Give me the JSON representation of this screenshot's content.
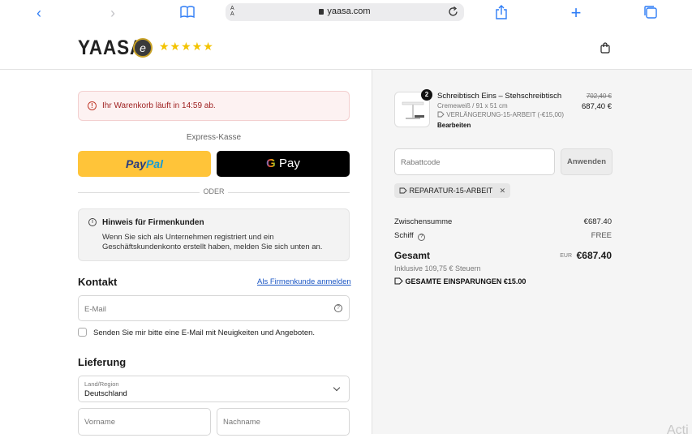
{
  "browser": {
    "url": "yaasa.com",
    "aa_label": "A A"
  },
  "header": {
    "logo": "YAASA",
    "seal_letter": "e",
    "stars": "★★★★★"
  },
  "cart_timer": "Ihr Warenkorb läuft in 14:59 ab.",
  "express": {
    "label": "Express-Kasse",
    "paypal_a": "Pay",
    "paypal_b": "Pal",
    "gpay_g": "G",
    "gpay_label": "Pay"
  },
  "oder": "ODER",
  "business_hint": {
    "title": "Hinweis für Firmenkunden",
    "body": "Wenn Sie sich als Unternehmen registriert und ein Geschäftskundenkonto erstellt haben, melden Sie sich unten an."
  },
  "contact": {
    "heading": "Kontakt",
    "business_login": "Als Firmenkunde anmelden",
    "email_placeholder": "E-Mail",
    "newsletter": "Senden Sie mir bitte eine E-Mail mit Neuigkeiten und Angeboten."
  },
  "delivery": {
    "heading": "Lieferung",
    "country_label": "Land/Region",
    "country_value": "Deutschland",
    "firstname_placeholder": "Vorname",
    "lastname_placeholder": "Nachname"
  },
  "summary": {
    "quantity": "2",
    "product_name": "Schreibtisch Eins – Stehschreibtisch",
    "variant": "Cremeweiß / 91 x 51 cm",
    "discount": "VERLÄNGERUNG-15-ARBEIT (-€15,00)",
    "edit": "Bearbeiten",
    "price_old": "702,40 €",
    "price_new": "687,40 €",
    "discount_placeholder": "Rabattcode",
    "apply": "Anwenden",
    "applied_code": "REPARATUR-15-ARBEIT",
    "subtotal_label": "Zwischensumme",
    "subtotal_value": "€687.40",
    "shipping_label": "Schiff",
    "shipping_value": "FREE",
    "total_label": "Gesamt",
    "currency": "EUR",
    "total_value": "€687.40",
    "taxes": "Inklusive 109,75 € Steuern",
    "savings": "GESAMTE EINSPARUNGEN €15.00"
  },
  "overlay_text": "Acti",
  "colors": {
    "paypal_yellow": "#ffc439",
    "timer_bg": "#fdf2f2",
    "link": "#1a56c4",
    "ios_blue": "#2f7df6"
  }
}
